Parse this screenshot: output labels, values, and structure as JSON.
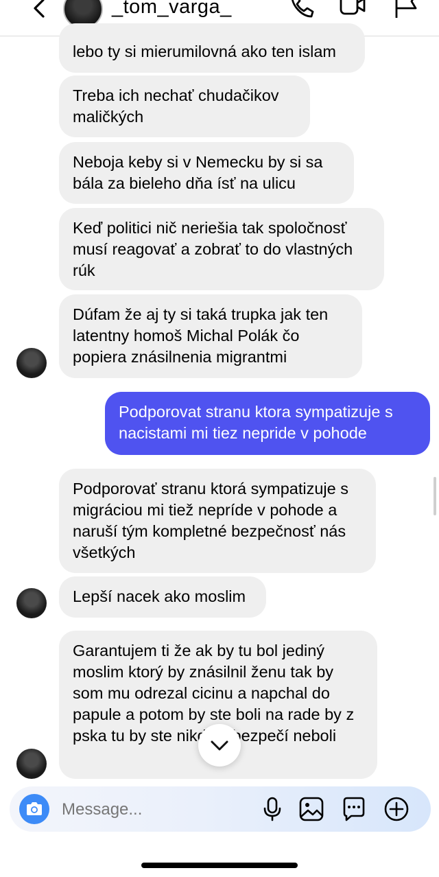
{
  "header": {
    "username": "_tom_varga_",
    "icons": [
      "back-chevron-icon",
      "avatar",
      "phone-icon",
      "video-camera-icon",
      "flag-icon"
    ]
  },
  "messages": [
    {
      "side": "in",
      "text": "lebo ty si mierumilovná ako ten islam"
    },
    {
      "side": "in",
      "text": "Treba ich nechať chudačikov maličkých"
    },
    {
      "side": "in",
      "text": "Neboja keby si v Nemecku by si sa bála za bieleho dňa ísť na ulicu"
    },
    {
      "side": "in",
      "text": "Keď politici nič neriešia tak spoločnosť musí reagovať a zobrať to do vlastných rúk"
    },
    {
      "side": "in",
      "text": "Dúfam že aj ty si taká trupka jak ten latentny homoš Michal Polák čo popiera znásilnenia migrantmi"
    },
    {
      "side": "out",
      "text": "Podporovat stranu ktora sympatizuje s nacistami mi tiez nepride v pohode"
    },
    {
      "side": "in",
      "text": "Podporovať stranu ktorá sympatizuje s migráciou mi tiež nepríde v pohode a naruší tým kompletné bezpečnosť nás všetkých"
    },
    {
      "side": "in",
      "text": "Lepší nacek ako moslim"
    },
    {
      "side": "in",
      "text": "Garantujem ti že ak by tu bol jediný moslim ktorý by znásilnil ženu tak by som mu odrezal cicinu a napchal do papule a potom by ste boli na rade by z pska tu by ste nikde v bezpečí neboli"
    }
  ],
  "composer": {
    "placeholder": "Message...",
    "icons": [
      "camera-icon",
      "microphone-icon",
      "gallery-icon",
      "sticker-icon",
      "add-icon"
    ]
  },
  "colors": {
    "outgoing_bubble": "#4f53f0",
    "incoming_bubble": "#efefef",
    "camera_button": "#3d8bf7"
  }
}
